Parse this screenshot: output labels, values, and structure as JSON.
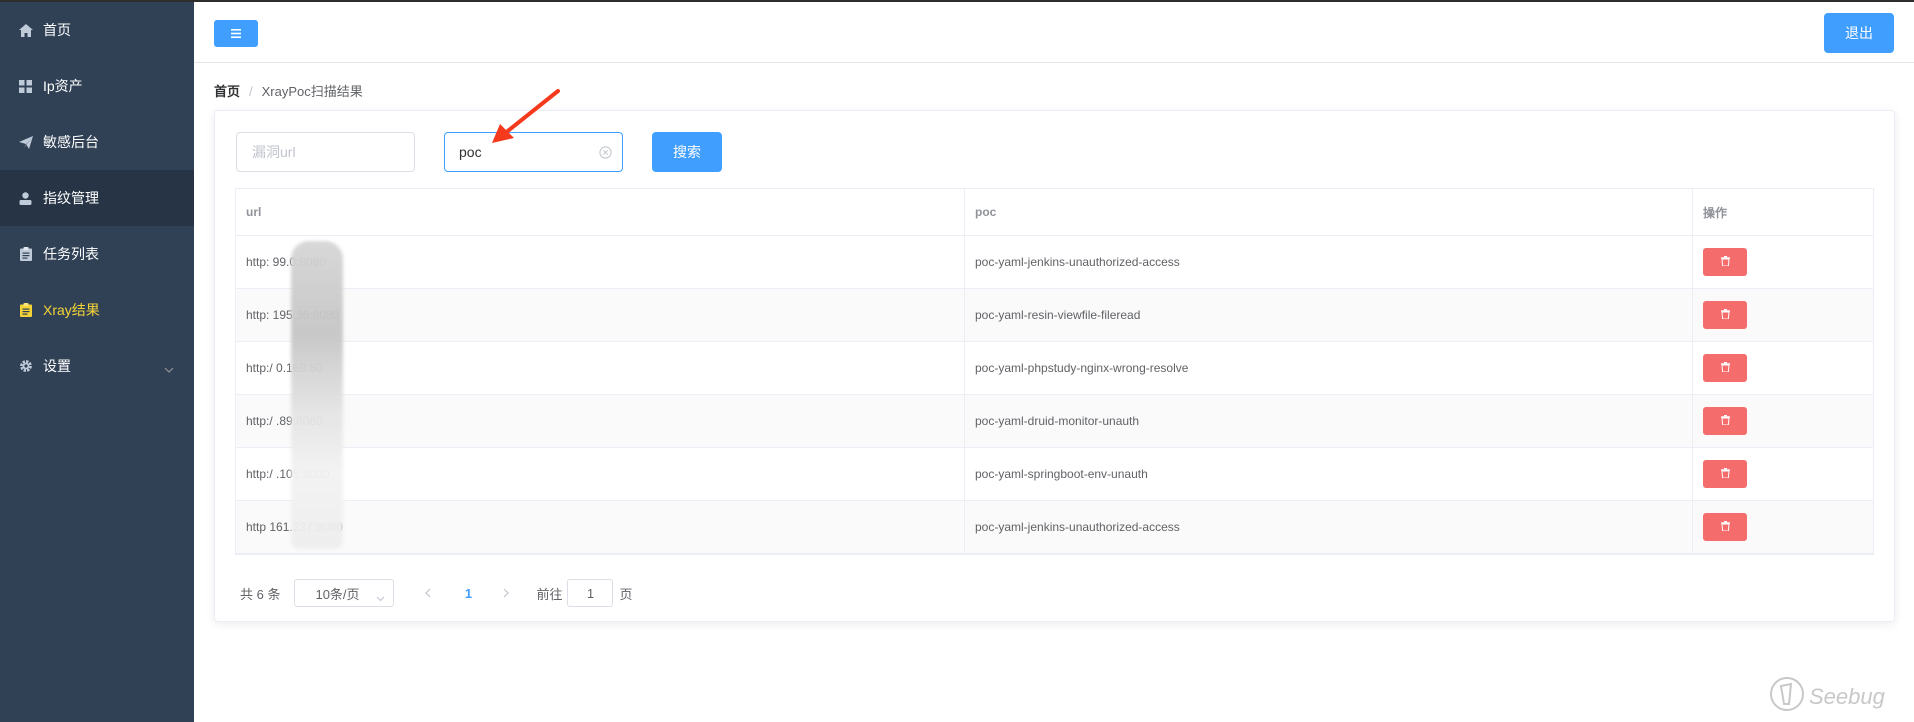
{
  "sidebar": {
    "items": [
      {
        "label": "首页",
        "icon": "home-icon"
      },
      {
        "label": "Ip资产",
        "icon": "grid-icon"
      },
      {
        "label": "敏感后台",
        "icon": "paper-plane-icon"
      },
      {
        "label": "指纹管理",
        "icon": "user-icon"
      },
      {
        "label": "任务列表",
        "icon": "clipboard-icon"
      },
      {
        "label": "Xray结果",
        "icon": "clipboard-icon"
      },
      {
        "label": "设置",
        "icon": "gear-icon"
      }
    ],
    "active_color": "#f4d336",
    "background": "#304156"
  },
  "header": {
    "menu_toggle_icon": "hamburger-icon",
    "logout_label": "退出"
  },
  "breadcrumb": {
    "home": "首页",
    "separator": "/",
    "current": "XrayPoc扫描结果"
  },
  "search": {
    "url_placeholder": "漏洞url",
    "poc_value": "poc",
    "button_label": "搜索"
  },
  "table": {
    "headers": {
      "url": "url",
      "poc": "poc",
      "action": "操作"
    },
    "rows": [
      {
        "url": "http:          99.0:8080",
        "poc": "poc-yaml-jenkins-unauthorized-access"
      },
      {
        "url": "http:          195.36:8080",
        "poc": "poc-yaml-resin-viewfile-fileread"
      },
      {
        "url": "http:/          0.169:80",
        "poc": "poc-yaml-phpstudy-nginx-wrong-resolve"
      },
      {
        "url": "http:/          .89:8080",
        "poc": "poc-yaml-druid-monitor-unauth"
      },
      {
        "url": "http:/          .105:8080",
        "poc": "poc-yaml-springboot-env-unauth"
      },
      {
        "url": "http          161.227:8080",
        "poc": "poc-yaml-jenkins-unauthorized-access"
      }
    ],
    "delete_icon": "trash-icon",
    "delete_color": "#f56c6c"
  },
  "pagination": {
    "total": "共 6 条",
    "page_size": "10条/页",
    "current_page": "1",
    "goto_label": "前往",
    "goto_value": "1",
    "goto_suffix": "页"
  },
  "watermark": "Seebug",
  "accent_color": "#409eff"
}
